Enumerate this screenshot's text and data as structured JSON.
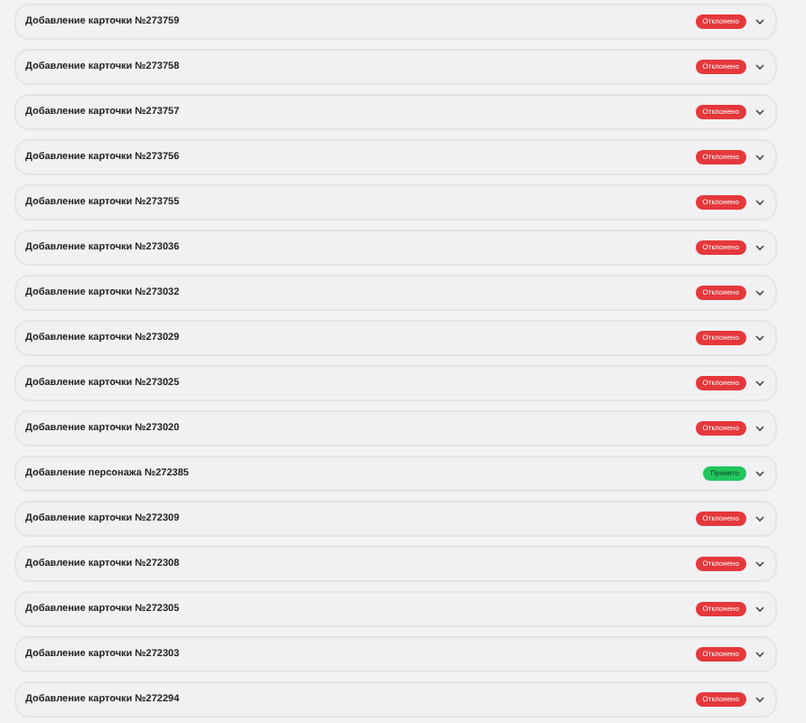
{
  "items": [
    {
      "title": "Добавление карточки №273759",
      "status": {
        "kind": "rejected",
        "label": "Отклонено"
      },
      "expanded": false
    },
    {
      "title": "Добавление карточки №273758",
      "status": {
        "kind": "rejected",
        "label": "Отклонено"
      },
      "expanded": false
    },
    {
      "title": "Добавление карточки №273757",
      "status": {
        "kind": "rejected",
        "label": "Отклонено"
      },
      "expanded": false
    },
    {
      "title": "Добавление карточки №273756",
      "status": {
        "kind": "rejected",
        "label": "Отклонено"
      },
      "expanded": false
    },
    {
      "title": "Добавление карточки №273755",
      "status": {
        "kind": "rejected",
        "label": "Отклонено"
      },
      "expanded": false
    },
    {
      "title": "Добавление карточки №273036",
      "status": {
        "kind": "rejected",
        "label": "Отклонено"
      },
      "expanded": false
    },
    {
      "title": "Добавление карточки №273032",
      "status": {
        "kind": "rejected",
        "label": "Отклонено"
      },
      "expanded": false
    },
    {
      "title": "Добавление карточки №273029",
      "status": {
        "kind": "rejected",
        "label": "Отклонено"
      },
      "expanded": false
    },
    {
      "title": "Добавление карточки №273025",
      "status": {
        "kind": "rejected",
        "label": "Отклонено"
      },
      "expanded": false
    },
    {
      "title": "Добавление карточки №273020",
      "status": {
        "kind": "rejected",
        "label": "Отклонено"
      },
      "expanded": false
    },
    {
      "title": "Добавление персонажа №272385",
      "status": {
        "kind": "accepted",
        "label": "Принято"
      },
      "expanded": false
    },
    {
      "title": "Добавление карточки №272309",
      "status": {
        "kind": "rejected",
        "label": "Отклонено"
      },
      "expanded": false
    },
    {
      "title": "Добавление карточки №272308",
      "status": {
        "kind": "rejected",
        "label": "Отклонено"
      },
      "expanded": false
    },
    {
      "title": "Добавление карточки №272305",
      "status": {
        "kind": "rejected",
        "label": "Отклонено"
      },
      "expanded": false
    },
    {
      "title": "Добавление карточки №272303",
      "status": {
        "kind": "rejected",
        "label": "Отклонено"
      },
      "expanded": false
    },
    {
      "title": "Добавление карточки №272294",
      "status": {
        "kind": "rejected",
        "label": "Отклонено"
      },
      "expanded": false
    }
  ]
}
